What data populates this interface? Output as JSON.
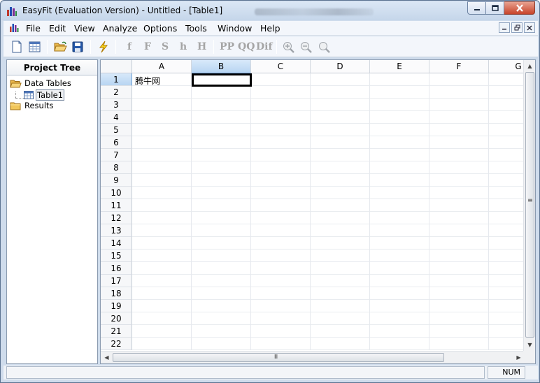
{
  "window": {
    "title": "EasyFit (Evaluation Version) - Untitled - [Table1]"
  },
  "menu": {
    "items": [
      {
        "label": "File"
      },
      {
        "label": "Edit"
      },
      {
        "label": "View"
      },
      {
        "label": "Analyze"
      },
      {
        "label": "Options"
      },
      {
        "label": "Tools"
      },
      {
        "label": "Window"
      },
      {
        "label": "Help"
      }
    ]
  },
  "toolbar": {
    "buttons": [
      {
        "icon": "new-document-icon"
      },
      {
        "icon": "new-table-icon"
      },
      {
        "icon": "open-folder-icon"
      },
      {
        "icon": "save-icon"
      },
      {
        "icon": "lightning-analyze-icon"
      },
      {
        "icon": "zoom-in-icon"
      },
      {
        "icon": "zoom-out-icon"
      },
      {
        "icon": "zoom-fit-icon"
      }
    ],
    "graph_buttons": {
      "f": "f",
      "F": "F",
      "S": "S",
      "h": "h",
      "H": "H",
      "pp": "PP",
      "qq": "QQ",
      "dif": "Dif"
    }
  },
  "project_tree": {
    "header": "Project Tree",
    "nodes": {
      "data_tables": "Data Tables",
      "table1": "Table1",
      "results": "Results"
    }
  },
  "grid": {
    "columns": [
      "A",
      "B",
      "C",
      "D",
      "E",
      "F",
      "G"
    ],
    "rows": [
      "1",
      "2",
      "3",
      "4",
      "5",
      "6",
      "7",
      "8",
      "9",
      "10",
      "11",
      "12",
      "13",
      "14",
      "15",
      "16",
      "17",
      "18",
      "19",
      "20",
      "21",
      "22"
    ],
    "selected_column": "B",
    "selected_row": "1",
    "cells": {
      "A1": "腾牛网"
    }
  },
  "scrollbars": {
    "grip": "III"
  },
  "status": {
    "main": "",
    "num": "NUM"
  },
  "colors": {
    "title_bar": "#c5d6ea",
    "selected_header": "#b8d5f2",
    "close_button": "#c7442a"
  }
}
